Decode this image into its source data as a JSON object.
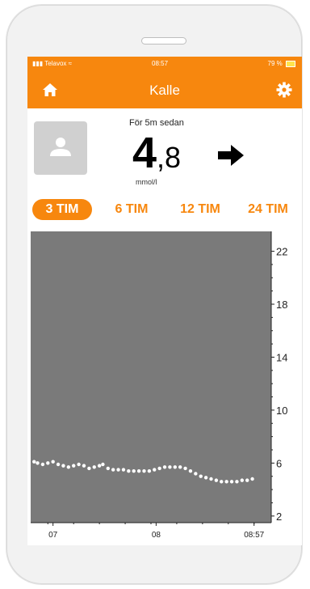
{
  "status_bar": {
    "carrier": "Telavox",
    "time": "08:57",
    "battery": "79 %"
  },
  "nav": {
    "title": "Kalle",
    "home_icon": "home-icon",
    "settings_icon": "gear-icon"
  },
  "reading": {
    "ago": "För 5m sedan",
    "value_int": "4",
    "value_dec": ",8",
    "unit": "mmol/l",
    "trend_icon": "arrow-right-icon"
  },
  "ranges": {
    "items": [
      "3 TIM",
      "6 TIM",
      "12 TIM",
      "24 TIM"
    ],
    "active": "3 TIM"
  },
  "colors": {
    "accent": "#f7870e",
    "chart_bg": "#7a7a7a",
    "points": "#ffffff"
  },
  "chart_data": {
    "type": "scatter",
    "y_ticks": [
      "22",
      "18",
      "14",
      "10",
      "6",
      "2"
    ],
    "ylim": [
      1.5,
      23.5
    ],
    "x_ticks": [
      "07",
      "08",
      "08:57"
    ],
    "x_tick_minutes": [
      -117,
      -57,
      0
    ],
    "xlim": [
      -130,
      10
    ],
    "points": [
      [
        -128,
        6.1
      ],
      [
        -126,
        6.0
      ],
      [
        -123,
        5.9
      ],
      [
        -120,
        6.0
      ],
      [
        -117,
        6.1
      ],
      [
        -114,
        5.9
      ],
      [
        -111,
        5.8
      ],
      [
        -108,
        5.7
      ],
      [
        -105,
        5.8
      ],
      [
        -102,
        5.9
      ],
      [
        -99,
        5.8
      ],
      [
        -96,
        5.6
      ],
      [
        -93,
        5.7
      ],
      [
        -90,
        5.8
      ],
      [
        -88,
        5.9
      ],
      [
        -85,
        5.6
      ],
      [
        -82,
        5.5
      ],
      [
        -79,
        5.5
      ],
      [
        -76,
        5.5
      ],
      [
        -73,
        5.4
      ],
      [
        -70,
        5.4
      ],
      [
        -67,
        5.4
      ],
      [
        -64,
        5.4
      ],
      [
        -61,
        5.4
      ],
      [
        -58,
        5.5
      ],
      [
        -55,
        5.6
      ],
      [
        -52,
        5.7
      ],
      [
        -49,
        5.7
      ],
      [
        -46,
        5.7
      ],
      [
        -43,
        5.7
      ],
      [
        -40,
        5.6
      ],
      [
        -37,
        5.4
      ],
      [
        -34,
        5.2
      ],
      [
        -31,
        5.0
      ],
      [
        -28,
        4.9
      ],
      [
        -25,
        4.8
      ],
      [
        -22,
        4.7
      ],
      [
        -19,
        4.6
      ],
      [
        -16,
        4.6
      ],
      [
        -13,
        4.6
      ],
      [
        -10,
        4.6
      ],
      [
        -7,
        4.7
      ],
      [
        -4,
        4.7
      ],
      [
        -1,
        4.8
      ]
    ]
  }
}
